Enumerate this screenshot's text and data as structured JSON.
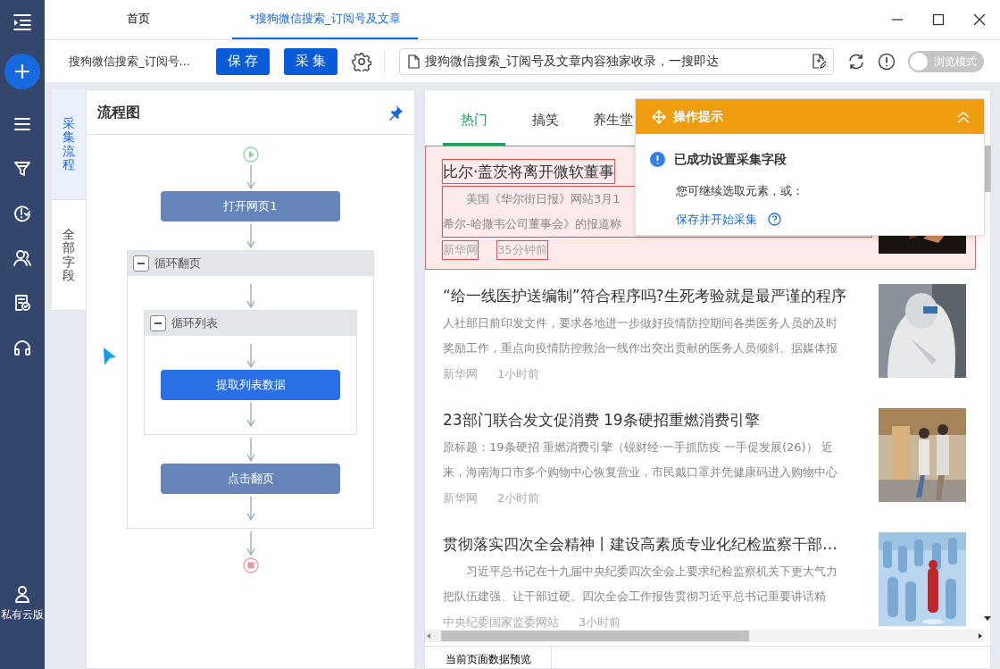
{
  "tabs": [
    {
      "label": "首页",
      "selected": false
    },
    {
      "label": "*搜狗微信搜索_订阅号及文章",
      "selected": true
    }
  ],
  "sidebar": {
    "footer_label": "私有云版"
  },
  "toolbar": {
    "task_name": "搜狗微信搜索_订阅号...",
    "buttons": [
      "保 存",
      "采 集"
    ],
    "url": "搜狗微信搜索_订阅号及文章内容独家收录，一搜即达",
    "browse_mode": {
      "label": "浏览模式",
      "on": false
    }
  },
  "side_tabs": [
    {
      "label": "采集流程",
      "selected": true
    },
    {
      "label": "全部字段",
      "selected": false
    }
  ],
  "flow": {
    "title": "流程图",
    "steps": [
      {
        "kind": "start"
      },
      {
        "kind": "action",
        "label": "打开网页1",
        "active": false
      },
      {
        "kind": "loop",
        "label": "循环翻页",
        "expanded": true,
        "children": [
          {
            "kind": "loop",
            "label": "循环列表",
            "expanded": true,
            "children": [
              {
                "kind": "action",
                "label": "提取列表数据",
                "active": true
              }
            ]
          },
          {
            "kind": "action",
            "label": "点击翻页",
            "active": false
          }
        ]
      },
      {
        "kind": "end"
      }
    ]
  },
  "browser": {
    "tabs": [
      {
        "label": "热门",
        "selected": true
      },
      {
        "label": "搞笑",
        "selected": false
      },
      {
        "label": "养生堂",
        "selected": false
      }
    ],
    "articles": [
      {
        "title": "比尔·盖茨将离开微软董事",
        "summary_lines": [
          "　　美国《华尔街日报》网站3月1",
          "希尔-哈撒韦公司董事会》的报道称"
        ],
        "source": "新华网",
        "time": "35分钟前",
        "selected": true
      },
      {
        "title": "“给一线医护送编制”符合程序吗?生死考验就是最严谨的程序",
        "summary_lines": [
          "人社部日前印发文件，要求各地进一步做好疫情防控期间各类医务人员的及时",
          "奖励工作，重点向疫情防控救治一线作出突出贡献的医务人员倾斜。据媒体报"
        ],
        "source": "新华网",
        "time": "1小时前",
        "selected": false
      },
      {
        "title": "23部门联合发文促消费 19条硬招重燃消费引擎",
        "summary_lines": [
          "原标题：19条硬招 重燃消费引擎（锐财经·一手抓防疫 一手促发展(26)） 近",
          "来，海南海口市多个购物中心恢复营业，市民戴口罩并凭健康码进入购物中心"
        ],
        "source": "新华网",
        "time": "2小时前",
        "selected": false
      },
      {
        "title": "贯彻落实四次全会精神丨建设高素质专业化纪检监察干部…",
        "summary_lines": [
          "　　习近平总书记在十九届中央纪委四次全会上要求纪检监察机关下更大气力",
          "把队伍建强、让干部过硬。四次全会工作报告贯彻习近平总书记重要讲话精"
        ],
        "source": "中央纪委国家监委网站",
        "time": "3小时前",
        "selected": false
      }
    ]
  },
  "tip": {
    "title": "操作提示",
    "message": "已成功设置采集字段",
    "hint": "您可继续选取元素，或：",
    "link": "保存并开始采集"
  },
  "preview_tab": {
    "label": "当前页面数据预览"
  }
}
